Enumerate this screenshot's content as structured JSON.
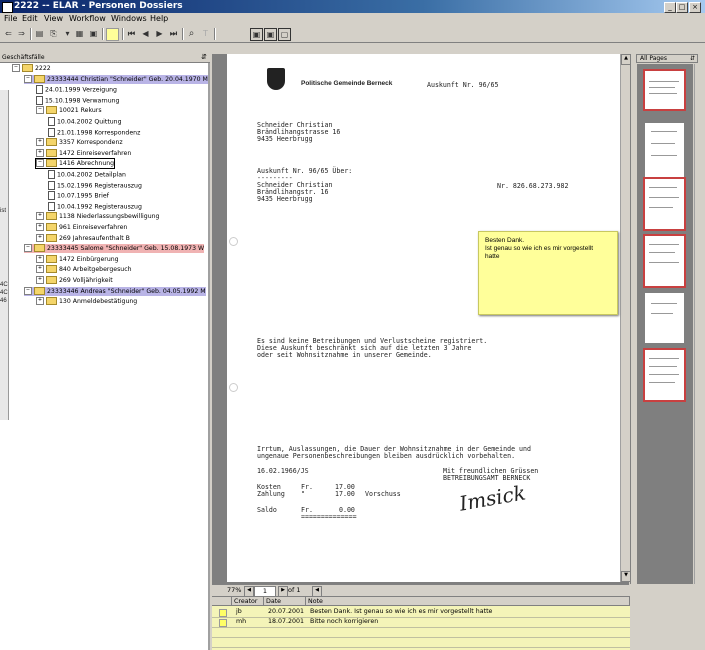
{
  "window": {
    "title": "2222  -- ELAR - Personen Dossiers",
    "controls": [
      "_",
      "□",
      "×"
    ]
  },
  "menu": [
    "File",
    "Edit",
    "View",
    "Workflow",
    "Windows",
    "Help"
  ],
  "left_panel": {
    "header": "Geschäftsfälle",
    "tree": [
      {
        "label": "2222",
        "type": "folder",
        "expander": "−"
      },
      {
        "label": "23333444 Christian \"Schneider\" Geb. 20.04.1970 M",
        "type": "folder",
        "expander": "−",
        "highlight": "blue"
      },
      {
        "label": "24.01.1999 Verzeigung",
        "type": "doc"
      },
      {
        "label": "15.10.1998 Verwarnung",
        "type": "doc"
      },
      {
        "label": "10021 Rekurs",
        "type": "folder",
        "expander": "−"
      },
      {
        "label": "10.04.2002 Quittung",
        "type": "doc"
      },
      {
        "label": "21.01.1998 Korrespondenz",
        "type": "doc"
      },
      {
        "label": "3357 Korrespondenz",
        "type": "folder",
        "expander": "+"
      },
      {
        "label": "1472 Einreiseverfahren",
        "type": "folder",
        "expander": "+"
      },
      {
        "label": "1416 Abrechnung",
        "type": "folder",
        "expander": "−",
        "highlight": "sel"
      },
      {
        "label": "10.04.2002 Detailplan",
        "type": "doc"
      },
      {
        "label": "15.02.1996 Registerauszug",
        "type": "doc"
      },
      {
        "label": "10.07.1995 Brief",
        "type": "doc"
      },
      {
        "label": "10.04.1992 Registerauszug",
        "type": "doc"
      },
      {
        "label": "1138 Niederlassungsbewilligung",
        "type": "folder",
        "expander": "+"
      },
      {
        "label": "961 Einreiseverfahren",
        "type": "folder",
        "expander": "+"
      },
      {
        "label": "269 Jahresaufenthalt B",
        "type": "folder",
        "expander": "+"
      },
      {
        "label": "23333445 Salome \"Schneider\" Geb. 15.08.1973 W",
        "type": "folder",
        "expander": "−",
        "highlight": "red"
      },
      {
        "label": "1472 Einbürgerung",
        "type": "folder",
        "expander": "+"
      },
      {
        "label": "840 Arbeitgebergesuch",
        "type": "folder",
        "expander": "+"
      },
      {
        "label": "269 Volljährigkeit",
        "type": "folder",
        "expander": "+"
      },
      {
        "label": "23333446 Andreas \"Schneider\" Geb. 04.05.1992 M",
        "type": "folder",
        "expander": "−",
        "highlight": "blue"
      },
      {
        "label": "130 Anmeldebestätigung",
        "type": "folder",
        "expander": "+"
      }
    ]
  },
  "left_strip_labels": [
    "ist",
    "4C",
    "4C",
    "46"
  ],
  "document": {
    "municipality": "Politische Gemeinde Berneck",
    "ref_top": "Auskunft  Nr. 96/65",
    "address": [
      "Schneider Christian",
      "Brändlihangstrasse 16",
      "9435 Heerbrugg"
    ],
    "ref_line": "Auskunft  Nr. 96/65       Über:",
    "ref_dash": "---------",
    "over": [
      "Schneider Christian",
      "Brändlihangstr. 16",
      "9435 Heerbrugg"
    ],
    "ref_nr": "Nr. 826.68.273.982",
    "body": [
      "Es sind keine Betreibungen und Verlustscheine registriert.",
      "Diese Auskunft beschränkt sich auf die letzten 3 Jahre",
      "oder seit Wohnsitznahme in unserer Gemeinde."
    ],
    "footer": [
      "Irrtum, Auslassungen, die Dauer der Wohnsitznahme in der Gemeinde und",
      "ungenaue Personenbeschreibungen bleiben ausdrücklich vorbehalten."
    ],
    "date": "16.02.1966/JS",
    "greeting": [
      "Mit freundlichen Grüssen",
      "BETREIBUNGSAMT BERNECK"
    ],
    "costs": [
      [
        "Kosten",
        "Fr.",
        "17.00",
        ""
      ],
      [
        "Zahlung",
        "\"",
        "17.00",
        "Vorschuss"
      ]
    ],
    "saldo": [
      "Saldo",
      "Fr.",
      "0.00"
    ],
    "saldo_line": "==============",
    "signature": "Imsick"
  },
  "sticky_note": [
    "Besten Dank.",
    "Ist genau so wie ich es mir vorgestellt",
    "hatte"
  ],
  "thumbnails": {
    "header": "All Pages"
  },
  "pager": {
    "zoom": "77%",
    "page": "1",
    "of": "of 1"
  },
  "notes_table": {
    "columns": [
      "Creator",
      "Date",
      "Note"
    ],
    "rows": [
      {
        "creator": "jb",
        "date": "20.07.2001",
        "note": "Besten Dank. Ist genau so wie ich es mir vorgestellt hatte"
      },
      {
        "creator": "mh",
        "date": "18.07.2001",
        "note": "Bitte noch korrigieren"
      }
    ]
  }
}
